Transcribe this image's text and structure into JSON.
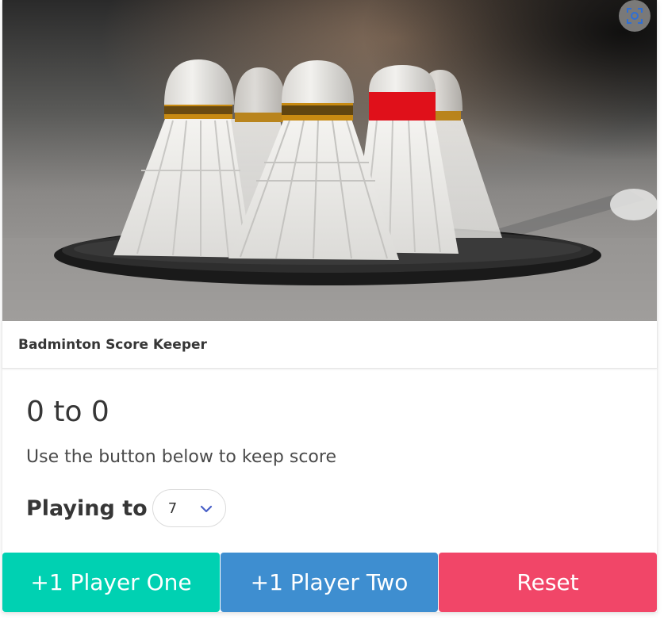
{
  "card": {
    "header_title": "Badminton Score Keeper",
    "image_alt": "Shuttlecocks on a badminton racket"
  },
  "score": {
    "player_one": 0,
    "player_two": 0,
    "display": "0 to 0"
  },
  "hint_text": "Use the button below to keep score",
  "playing_to": {
    "label": "Playing to",
    "selected": "7"
  },
  "buttons": {
    "player_one": "+1 Player One",
    "player_two": "+1 Player Two",
    "reset": "Reset"
  },
  "colors": {
    "player_one": "#00d1b2",
    "player_two": "#3e8ed0",
    "reset": "#f14668",
    "cork_band_gold": "#c78a12",
    "cork_band_red": "#e0101a"
  },
  "icons": {
    "visual_search": "visual-search-icon",
    "select_arrow": "chevron-down-icon"
  }
}
